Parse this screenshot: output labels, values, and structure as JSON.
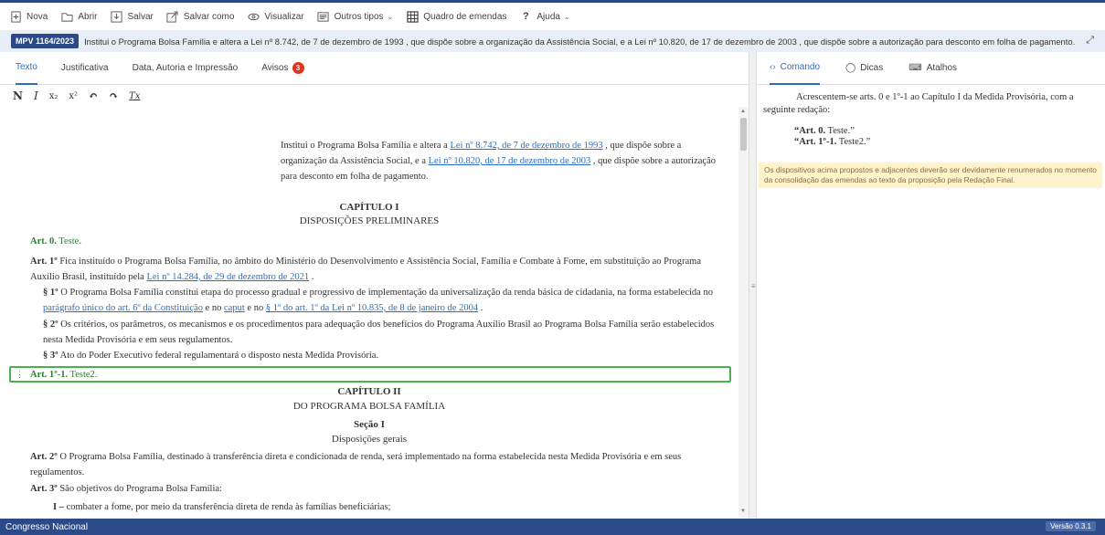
{
  "toolbar": {
    "items": [
      {
        "label": "Nova",
        "icon": "new-document-icon",
        "chevron": false
      },
      {
        "label": "Abrir",
        "icon": "folder-icon",
        "chevron": false
      },
      {
        "label": "Salvar",
        "icon": "save-icon",
        "chevron": false
      },
      {
        "label": "Salvar como",
        "icon": "save-as-icon",
        "chevron": false
      },
      {
        "label": "Visualizar",
        "icon": "eye-icon",
        "chevron": false
      },
      {
        "label": "Outros tipos",
        "icon": "document-icon",
        "chevron": true
      },
      {
        "label": "Quadro de emendas",
        "icon": "table-icon",
        "chevron": false
      },
      {
        "label": "Ajuda",
        "icon": "help-icon",
        "chevron": true
      }
    ]
  },
  "infobar": {
    "badge": "MPV 1164/2023",
    "ementa": "Institui o Programa Bolsa Família e altera a Lei nº 8.742, de 7 de dezembro de 1993 , que dispõe sobre a organização da Assistência Social, e a Lei nº 10.820, de 17 de dezembro de 2003 , que dispõe sobre a autorização para desconto em folha de pagamento."
  },
  "left_tabs": {
    "texto": "Texto",
    "justificativa": "Justificativa",
    "data_autoria": "Data, Autoria e Impressão",
    "avisos": "Avisos",
    "avisos_count": "3"
  },
  "format_bar": {
    "bold": "N",
    "italic": "I",
    "subscript": "x₂",
    "superscript": "x²",
    "undo": "↶",
    "redo": "↷",
    "clear": "Tx"
  },
  "document": {
    "ementa_a": "Institui o Programa Bolsa Família e altera a ",
    "ementa_link1": "Lei nº 8.742, de 7 de dezembro de 1993",
    "ementa_b": " , que dispõe sobre a organização da Assistência Social, e a ",
    "ementa_link2": "Lei nº 10.820, de 17 de dezembro de 2003",
    "ementa_c": " , que dispõe sobre a autorização para desconto em folha de pagamento.",
    "cap1_title": "CAPÍTULO I",
    "cap1_sub": "DISPOSIÇÕES PRELIMINARES",
    "art0_label": "Art. 0.",
    "art0_text": " Teste.",
    "art1_label": "Art. 1º",
    "art1_text": " Fica instituído o Programa Bolsa Família, no âmbito do Ministério do Desenvolvimento e Assistência Social, Família e Combate à Fome, em substituição ao Programa Auxílio Brasil, instituído pela ",
    "art1_link": "Lei nº 14.284, de 29 de dezembro de 2021",
    "art1_end": " .",
    "p1_label": "§ 1º",
    "p1_text": " O Programa Bolsa Família constitui etapa do processo gradual e progressivo de implementação da universalização da renda básica de cidadania, na forma estabelecida no ",
    "p1_link1": "parágrafo único do art. 6º da Constituição",
    "p1_mid1": " e no ",
    "p1_link2": "caput",
    "p1_mid2": " e no ",
    "p1_link3": "§ 1º do art. 1º da Lei nº 10.835, de 8 de janeiro de 2004",
    "p1_end": " .",
    "p2_label": "§ 2º",
    "p2_text": " Os critérios, os parâmetros, os mecanismos e os procedimentos para adequação dos benefícios do Programa Auxílio Brasil ao Programa Bolsa Família serão estabelecidos nesta Medida Provisória e em seus regulamentos.",
    "p3_label": "§ 3º",
    "p3_text": " Ato do Poder Executivo federal regulamentará o disposto nesta Medida Provisória.",
    "art1_1_label": "Art. 1º-1.",
    "art1_1_text": " Teste2.",
    "cap2_title": "CAPÍTULO II",
    "cap2_sub": "DO PROGRAMA BOLSA FAMÍLIA",
    "secao_title": "Seção I",
    "secao_sub": "Disposições gerais",
    "art2_label": "Art. 2º",
    "art2_text": " O Programa Bolsa Família, destinado à transferência direta e condicionada de renda, será implementado na forma estabelecida nesta Medida Provisória e em seus regulamentos.",
    "art3_label": "Art. 3º",
    "art3_text": " São objetivos do Programa Bolsa Família:",
    "inc1_label": "I –",
    "inc1_text": " combater a fome, por meio da transferência direta de renda às famílias beneficiárias;"
  },
  "right_tabs": {
    "comando": "Comando",
    "dicas": "Dicas",
    "atalhos": "Atalhos"
  },
  "comando": {
    "text": "Acrescentem-se arts. 0 e 1º-1 ao Capítulo I da Medida Provisória, com a seguinte redação:",
    "q1_label": "“Art. 0.",
    "q1_text": " Teste.”",
    "q2_label": "“Art. 1º-1.",
    "q2_text": " Teste2.”",
    "notice": "Os dispositivos acima propostos e adjacentes deverão ser devidamente renumerados no momento da consolidação das emendas ao texto da proposição pela Redação Final."
  },
  "footer": {
    "title": "Congresso Nacional",
    "version": "Versão 0.3.1"
  },
  "colors": {
    "primary": "#2c4a87",
    "accent": "#2c6fc2",
    "green": "#2e7d32",
    "badge_red": "#e0341f",
    "notice_bg": "#fff3cd"
  }
}
